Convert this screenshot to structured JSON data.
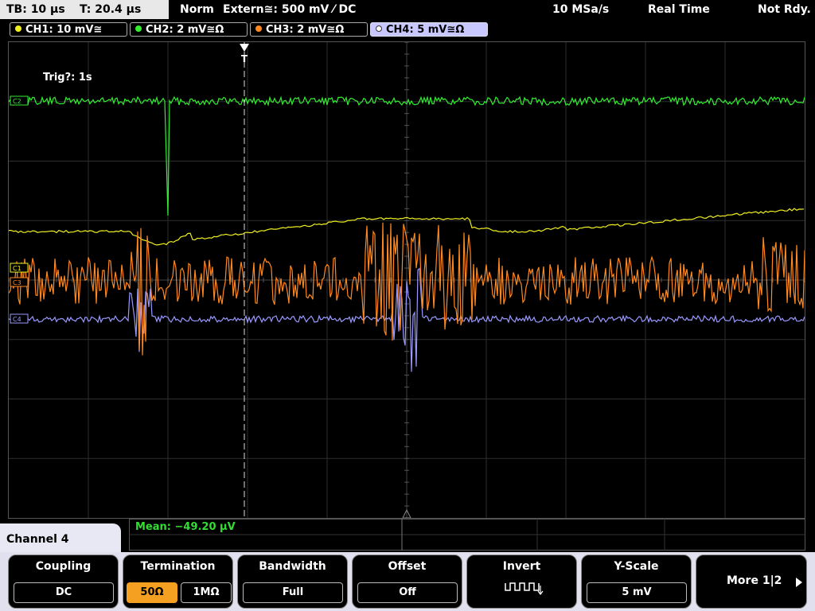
{
  "status": {
    "timebase": "TB: 10 µs",
    "trigger_time": "T: 20.4 µs",
    "trigger_mode": "Norm",
    "trigger_source": "Extern≅: 500 mV ⁄ DC",
    "sample_rate": "10 MSa/s",
    "acq_mode": "Real Time",
    "ready": "Not Rdy."
  },
  "channels": [
    {
      "label": "CH1: 10 mV≅",
      "color": "#f0f020"
    },
    {
      "label": "CH2: 2 mV≅Ω",
      "color": "#33ee33"
    },
    {
      "label": "CH3: 2 mV≅Ω",
      "color": "#ff8820"
    },
    {
      "label": "CH4: 5 mV≅Ω",
      "color": "#9999ff"
    }
  ],
  "plot": {
    "trigger_status": "Trig?: 1s",
    "markers": {
      "ch1": "C1",
      "ch2": "C2",
      "ch3": "C3",
      "ch4": "C4"
    },
    "trigger_marker": "T"
  },
  "measurement": {
    "mean": "Mean: −49.20 µV"
  },
  "menu": {
    "title": "Channel 4",
    "coupling": {
      "title": "Coupling",
      "value": "DC"
    },
    "termination": {
      "title": "Termination",
      "opt1": "50Ω",
      "opt2": "1MΩ"
    },
    "bandwidth": {
      "title": "Bandwidth",
      "value": "Full"
    },
    "offset": {
      "title": "Offset",
      "value": "Off"
    },
    "invert": {
      "title": "Invert"
    },
    "yscale": {
      "title": "Y-Scale",
      "value": "5 mV"
    },
    "more": {
      "label": "More 1|2"
    }
  }
}
